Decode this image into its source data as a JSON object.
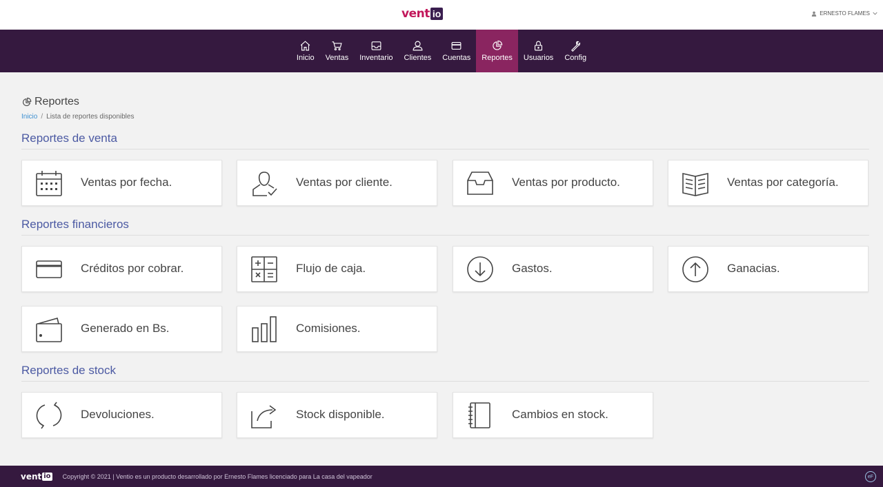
{
  "brand": {
    "logo_main": "vent",
    "logo_box": "io"
  },
  "user": {
    "name": "ERNESTO FLAMES"
  },
  "nav": [
    {
      "label": "Inicio",
      "icon": "home-icon"
    },
    {
      "label": "Ventas",
      "icon": "cart-icon"
    },
    {
      "label": "Inventario",
      "icon": "inbox-icon"
    },
    {
      "label": "Clientes",
      "icon": "user-icon"
    },
    {
      "label": "Cuentas",
      "icon": "credit-card-icon"
    },
    {
      "label": "Reportes",
      "icon": "pie-chart-icon",
      "active": true
    },
    {
      "label": "Usuarios",
      "icon": "lock-icon"
    },
    {
      "label": "Config",
      "icon": "wrench-icon"
    }
  ],
  "page": {
    "title": "Reportes"
  },
  "breadcrumb": {
    "home": "Inicio",
    "current": "Lista de reportes disponibles"
  },
  "sections": {
    "venta": {
      "title": "Reportes de venta",
      "cards": [
        {
          "label": "Ventas por fecha.",
          "icon": "calendar-icon"
        },
        {
          "label": "Ventas por cliente.",
          "icon": "user-check-icon"
        },
        {
          "label": "Ventas por producto.",
          "icon": "inbox-icon"
        },
        {
          "label": "Ventas por categoría.",
          "icon": "book-icon"
        }
      ]
    },
    "financieros": {
      "title": "Reportes financieros",
      "cards": [
        {
          "label": "Créditos por cobrar.",
          "icon": "credit-card-icon"
        },
        {
          "label": "Flujo de caja.",
          "icon": "calculator-icon"
        },
        {
          "label": "Gastos.",
          "icon": "arrow-down-circle-icon"
        },
        {
          "label": "Ganacias.",
          "icon": "arrow-up-circle-icon"
        },
        {
          "label": "Generado en Bs.",
          "icon": "wallet-icon"
        },
        {
          "label": "Comisiones.",
          "icon": "bar-chart-icon"
        }
      ]
    },
    "stock": {
      "title": "Reportes de stock",
      "cards": [
        {
          "label": "Devoluciones.",
          "icon": "refresh-icon"
        },
        {
          "label": "Stock disponible.",
          "icon": "share-icon"
        },
        {
          "label": "Cambios en stock.",
          "icon": "notebook-icon"
        }
      ]
    }
  },
  "footer": {
    "logo_main": "vent",
    "logo_box": "io",
    "text": "Copyright © 2021 | Ventio es un producto desarrollado por Ernesto Flames licenciado para La casa del vapeador",
    "badge": "eF"
  },
  "colors": {
    "nav_bg": "#35193f",
    "nav_active": "#8a2560",
    "section_title": "#4c5aa3",
    "brand": "#c2185b"
  }
}
